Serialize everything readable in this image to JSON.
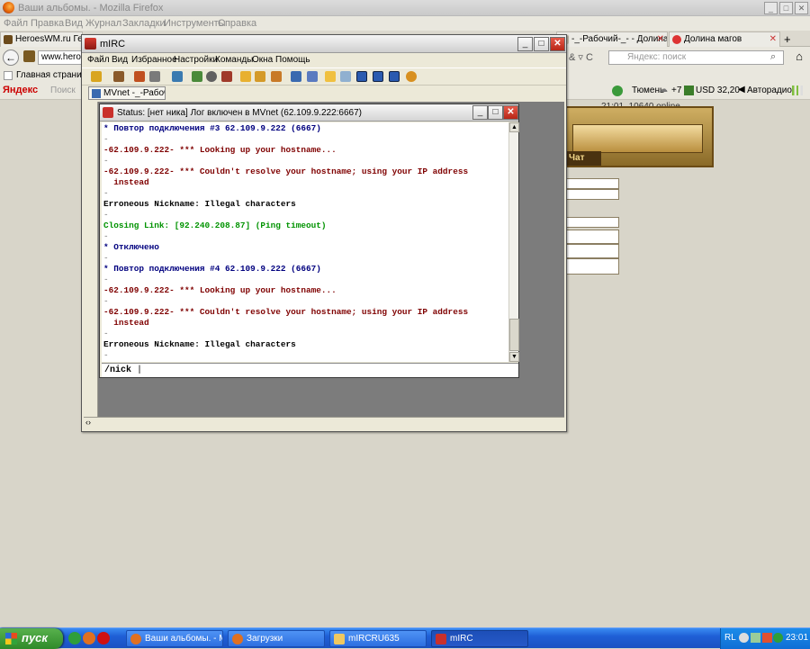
{
  "firefox": {
    "title": "Ваши альбомы. - Mozilla Firefox",
    "menu": [
      "Файл",
      "Правка",
      "Вид",
      "Журнал",
      "Закладки",
      "Инструменты",
      "Справка"
    ],
    "tabs": [
      "HeroesWM.ru Герои",
      "-_-Рабочий-_- - Долина ...",
      "Долина магов"
    ],
    "new_tab": "+",
    "url": "www.heroes",
    "search_placeholder": "Яндекс: поиск",
    "bookmark": "Главная страница Li",
    "yandex_logo": "Яндекс",
    "yandex_search": "Поиск",
    "weather_delta": "+7",
    "city": "Тюмень",
    "currency": "USD 32,20",
    "autoradio": "Авторадио"
  },
  "game": {
    "stats": "21:01, 10640 online",
    "chat_label": "Чат"
  },
  "mirc": {
    "title": "mIRC",
    "menu": [
      "Файл",
      "Вид",
      "Избранное",
      "Настройки",
      "Команды",
      "Окна",
      "Помощь"
    ],
    "switch_button": "MVnet -_-Рабочи...",
    "status_title": "Status: [нет ника] Лог включен в MVnet (62.109.9.222:6667)",
    "input_value": "/nick",
    "lines": [
      {
        "text": "* Повтор подключения #3 62.109.9.222 (6667)",
        "color": "#00007f"
      },
      {
        "text": "-",
        "color": "#777777"
      },
      {
        "text": "-62.109.9.222- *** Looking up your hostname...",
        "color": "#7f0000"
      },
      {
        "text": "-",
        "color": "#777777"
      },
      {
        "text": "-62.109.9.222- *** Couldn't resolve your hostname; using your IP address",
        "color": "#7f0000"
      },
      {
        "text": "  instead",
        "color": "#7f0000"
      },
      {
        "text": "-",
        "color": "#777777"
      },
      {
        "text": "Erroneous Nickname: Illegal characters",
        "color": "#000000"
      },
      {
        "text": "-",
        "color": "#777777"
      },
      {
        "text": "Closing Link: [92.240.208.87] (Ping timeout)",
        "color": "#009300"
      },
      {
        "text": "-",
        "color": "#777777"
      },
      {
        "text": "* Отключено",
        "color": "#00007f"
      },
      {
        "text": "-",
        "color": "#777777"
      },
      {
        "text": "* Повтор подключения #4 62.109.9.222 (6667)",
        "color": "#00007f"
      },
      {
        "text": "-",
        "color": "#777777"
      },
      {
        "text": "-62.109.9.222- *** Looking up your hostname...",
        "color": "#7f0000"
      },
      {
        "text": "-",
        "color": "#777777"
      },
      {
        "text": "-62.109.9.222- *** Couldn't resolve your hostname; using your IP address",
        "color": "#7f0000"
      },
      {
        "text": "  instead",
        "color": "#7f0000"
      },
      {
        "text": "-",
        "color": "#777777"
      },
      {
        "text": "Erroneous Nickname: Illegal characters",
        "color": "#000000"
      },
      {
        "text": "-",
        "color": "#777777"
      }
    ]
  },
  "taskbar": {
    "start": "пуск",
    "tasks": [
      "Ваши альбомы. - Мо...",
      "Загрузки",
      "mIRCRU635",
      "mIRC"
    ],
    "lang": "RL",
    "clock": "23:01"
  }
}
